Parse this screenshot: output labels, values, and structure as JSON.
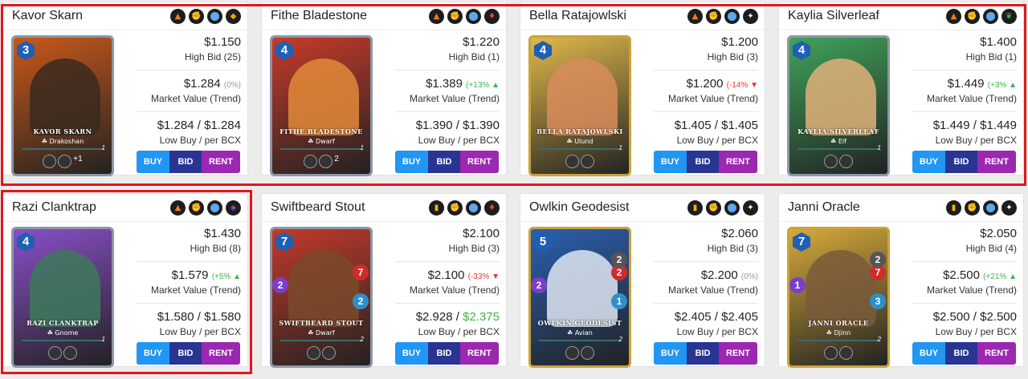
{
  "cards": [
    {
      "name": "Kavor Skarn",
      "mana": "3",
      "art_name": "KAVOR SKARN",
      "race": "Drakoshan",
      "level": "1",
      "rarity": "silver",
      "bg": "#c9591a",
      "fig": "#3a2a20",
      "badges": [
        "fire-icon",
        "melee-icon",
        "water-icon",
        "earth-icon"
      ],
      "stats": {
        "hp": "",
        "atk": "",
        "mag": "",
        "spd": ""
      },
      "high_bid": "$1.150",
      "high_bid_label": "High Bid (25)",
      "market": "$1.284",
      "trend": "(0%)",
      "trend_dir": "flat",
      "market_label": "Market Value (Trend)",
      "low_buy": "$1.284",
      "per_bcx": "$1.284",
      "per_bcx_green": false,
      "low_label": "Low Buy / per BCX",
      "ability_extra": "+1"
    },
    {
      "name": "Fithe Bladestone",
      "mana": "4",
      "art_name": "FITHE BLADESTONE",
      "race": "Dwarf",
      "level": "1",
      "rarity": "silver",
      "bg": "#c73a2a",
      "fig": "#e08a3a",
      "badges": [
        "fire-icon",
        "melee-icon",
        "water-icon",
        "fire-drop-icon"
      ],
      "stats": {
        "hp": "",
        "atk": "",
        "mag": "",
        "spd": ""
      },
      "high_bid": "$1.220",
      "high_bid_label": "High Bid (1)",
      "market": "$1.389",
      "trend": "(+13%",
      "trend_dir": "up",
      "market_label": "Market Value (Trend)",
      "low_buy": "$1.390",
      "per_bcx": "$1.390",
      "per_bcx_green": false,
      "low_label": "Low Buy / per BCX",
      "ability_extra": "2"
    },
    {
      "name": "Bella Ratajowlski",
      "mana": "4",
      "art_name": "BELLA RATAJOWLSKI",
      "race": "Ulund",
      "level": "1",
      "rarity": "gold",
      "bg": "#e0b84a",
      "fig": "#d98c5a",
      "badges": [
        "fire-icon",
        "melee-icon",
        "water-icon",
        "star-icon"
      ],
      "stats": {
        "hp": "",
        "atk": "",
        "mag": "",
        "spd": ""
      },
      "high_bid": "$1.200",
      "high_bid_label": "High Bid (3)",
      "market": "$1.200",
      "trend": "(-14%",
      "trend_dir": "down",
      "market_label": "Market Value (Trend)",
      "low_buy": "$1.405",
      "per_bcx": "$1.405",
      "per_bcx_green": false,
      "low_label": "Low Buy / per BCX",
      "ability_extra": ""
    },
    {
      "name": "Kaylia Silverleaf",
      "mana": "4",
      "art_name": "KAYLIA SILVERLEAF",
      "race": "Elf",
      "level": "1",
      "rarity": "silver",
      "bg": "#3fa35a",
      "fig": "#e0b07a",
      "badges": [
        "fire-icon",
        "melee-icon",
        "water-icon",
        "leaf-icon"
      ],
      "stats": {
        "hp": "",
        "atk": "",
        "mag": "",
        "spd": ""
      },
      "high_bid": "$1.400",
      "high_bid_label": "High Bid (1)",
      "market": "$1.449",
      "trend": "(+3%",
      "trend_dir": "up",
      "market_label": "Market Value (Trend)",
      "low_buy": "$1.449",
      "per_bcx": "$1.449",
      "per_bcx_green": false,
      "low_label": "Low Buy / per BCX",
      "ability_extra": ""
    },
    {
      "name": "Razi Clanktrap",
      "mana": "4",
      "art_name": "RAZI CLANKTRAP",
      "race": "Gnome",
      "level": "1",
      "rarity": "silver",
      "bg": "#8a4fc9",
      "fig": "#3c7a5a",
      "badges": [
        "fire-icon",
        "melee-icon",
        "water-icon",
        "gem-icon"
      ],
      "stats": {
        "hp": "",
        "atk": "",
        "mag": "",
        "spd": ""
      },
      "high_bid": "$1.430",
      "high_bid_label": "High Bid (8)",
      "market": "$1.579",
      "trend": "(+5%",
      "trend_dir": "up",
      "market_label": "Market Value (Trend)",
      "low_buy": "$1.580",
      "per_bcx": "$1.580",
      "per_bcx_green": false,
      "low_label": "Low Buy / per BCX",
      "ability_extra": ""
    },
    {
      "name": "Swiftbeard Stout",
      "mana": "7",
      "art_name": "SWIFTBEARD STOUT",
      "race": "Dwarf",
      "level": "2",
      "rarity": "silver",
      "bg": "#c23a2a",
      "fig": "#7a4a2a",
      "badges": [
        "card-icon",
        "melee-icon",
        "water-icon",
        "fire-drop-icon"
      ],
      "stats": {
        "hp": "7",
        "atk": "",
        "mag": "2",
        "spd": "2"
      },
      "high_bid": "$2.100",
      "high_bid_label": "High Bid (3)",
      "market": "$2.100",
      "trend": "(-33%",
      "trend_dir": "down",
      "market_label": "Market Value (Trend)",
      "low_buy": "$2.928",
      "per_bcx": "$2.375",
      "per_bcx_green": true,
      "low_label": "Low Buy / per BCX",
      "ability_extra": ""
    },
    {
      "name": "Owlkin Geodesist",
      "mana": "5",
      "art_name": "OWLKIN GEODESIST",
      "race": "Avian",
      "level": "2",
      "rarity": "gold",
      "bg": "#2b5fb0",
      "fig": "#dde6f2",
      "badges": [
        "card-icon",
        "melee-icon",
        "water-icon",
        "star-icon"
      ],
      "stats": {
        "hp": "2",
        "atk": "2",
        "mag": "2",
        "spd": "1"
      },
      "high_bid": "$2.060",
      "high_bid_label": "High Bid (3)",
      "market": "$2.200",
      "trend": "(0%)",
      "trend_dir": "flat",
      "market_label": "Market Value (Trend)",
      "low_buy": "$2.405",
      "per_bcx": "$2.405",
      "per_bcx_green": false,
      "low_label": "Low Buy / per BCX",
      "ability_extra": ""
    },
    {
      "name": "Janni Oracle",
      "mana": "7",
      "art_name": "JANNI ORACLE",
      "race": "Djinn",
      "level": "2",
      "rarity": "gold",
      "bg": "#d6a93a",
      "fig": "#7a5a3a",
      "badges": [
        "card-icon",
        "melee-icon",
        "water-icon",
        "star-icon"
      ],
      "stats": {
        "hp": "7",
        "atk": "2",
        "mag": "1",
        "spd": "3"
      },
      "high_bid": "$2.050",
      "high_bid_label": "High Bid (4)",
      "market": "$2.500",
      "trend": "(+21%",
      "trend_dir": "up",
      "market_label": "Market Value (Trend)",
      "low_buy": "$2.500",
      "per_bcx": "$2.500",
      "per_bcx_green": false,
      "low_label": "Low Buy / per BCX",
      "ability_extra": ""
    }
  ],
  "buttons": {
    "buy": "BUY",
    "bid": "BID",
    "rent": "RENT"
  },
  "colors": {
    "highlight": "#e2161d",
    "buy": "#2196f3",
    "bid": "#283593",
    "rent": "#9c27b0",
    "up": "#3bb54a",
    "down": "#e33333"
  }
}
